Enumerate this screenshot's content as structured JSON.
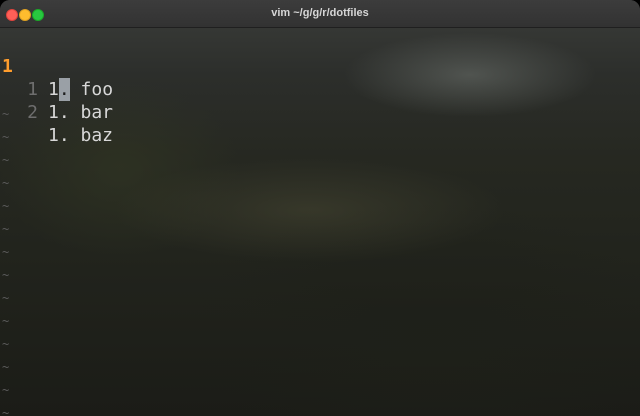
{
  "window": {
    "title": "vim ~/g/g/r/dotfiles"
  },
  "editor": {
    "lines": [
      {
        "number": "1",
        "relative": false,
        "content_prefix": "1",
        "cursor_char": ".",
        "content_rest": " foo"
      },
      {
        "number": "1",
        "relative": true,
        "content_prefix": "1. bar",
        "cursor_char": "",
        "content_rest": ""
      },
      {
        "number": "2",
        "relative": true,
        "content_prefix": "1. baz",
        "cursor_char": "",
        "content_rest": ""
      }
    ],
    "empty_line_marker": "~"
  },
  "colors": {
    "current_line_number": "#ff9d2d",
    "line_number": "#6e6e6e",
    "text": "#d8d8d8",
    "cursor": "#9aa0a6"
  }
}
